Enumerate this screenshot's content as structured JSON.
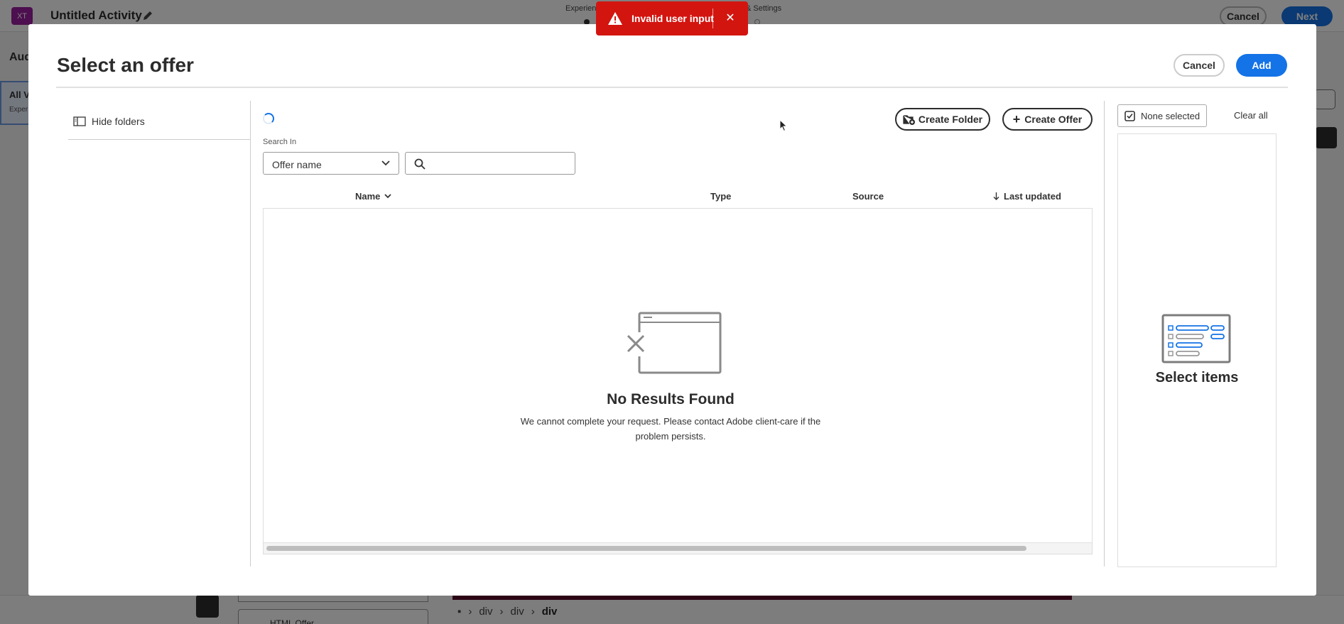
{
  "background_app": {
    "logo": "XT",
    "activity_title": "Untitled Activity",
    "steps_left_label": "Experien",
    "steps_right_label": "& Settings",
    "cancel_label": "Cancel",
    "next_label": "Next",
    "audiences_heading": "Aud",
    "all_visitors_label": "All V",
    "all_visitors_sub": "Exper",
    "html_offer_label": "HTML Offer",
    "breadcrumb": [
      "div",
      "div",
      "div"
    ]
  },
  "toast": {
    "message": "Invalid user input",
    "variant": "negative",
    "color": "#d31510",
    "icon": "alert-icon",
    "close_icon": "close-icon"
  },
  "modal": {
    "title": "Select an offer",
    "cancel_label": "Cancel",
    "add_label": "Add",
    "hide_folders_label": "Hide folders",
    "create_folder_label": "Create Folder",
    "create_offer_label": "Create Offer",
    "search_in_label": "Search In",
    "search_in_value": "Offer name",
    "search_placeholder": "",
    "table": {
      "columns": [
        {
          "label": "Name",
          "sort_icon": "chevron-down-icon"
        },
        {
          "label": "Type"
        },
        {
          "label": "Source"
        },
        {
          "label": "Last updated",
          "sort_icon": "arrow-down-icon"
        }
      ],
      "empty_title": "No Results Found",
      "empty_description": "We cannot complete your request. Please contact Adobe client-care if the problem persists."
    },
    "selection": {
      "none_selected_label": "None selected",
      "clear_all_label": "Clear all",
      "empty_title": "Select items"
    }
  },
  "colors": {
    "accent": "#1473e6",
    "negative": "#d31510",
    "logo_bg": "#9b1f9f"
  }
}
